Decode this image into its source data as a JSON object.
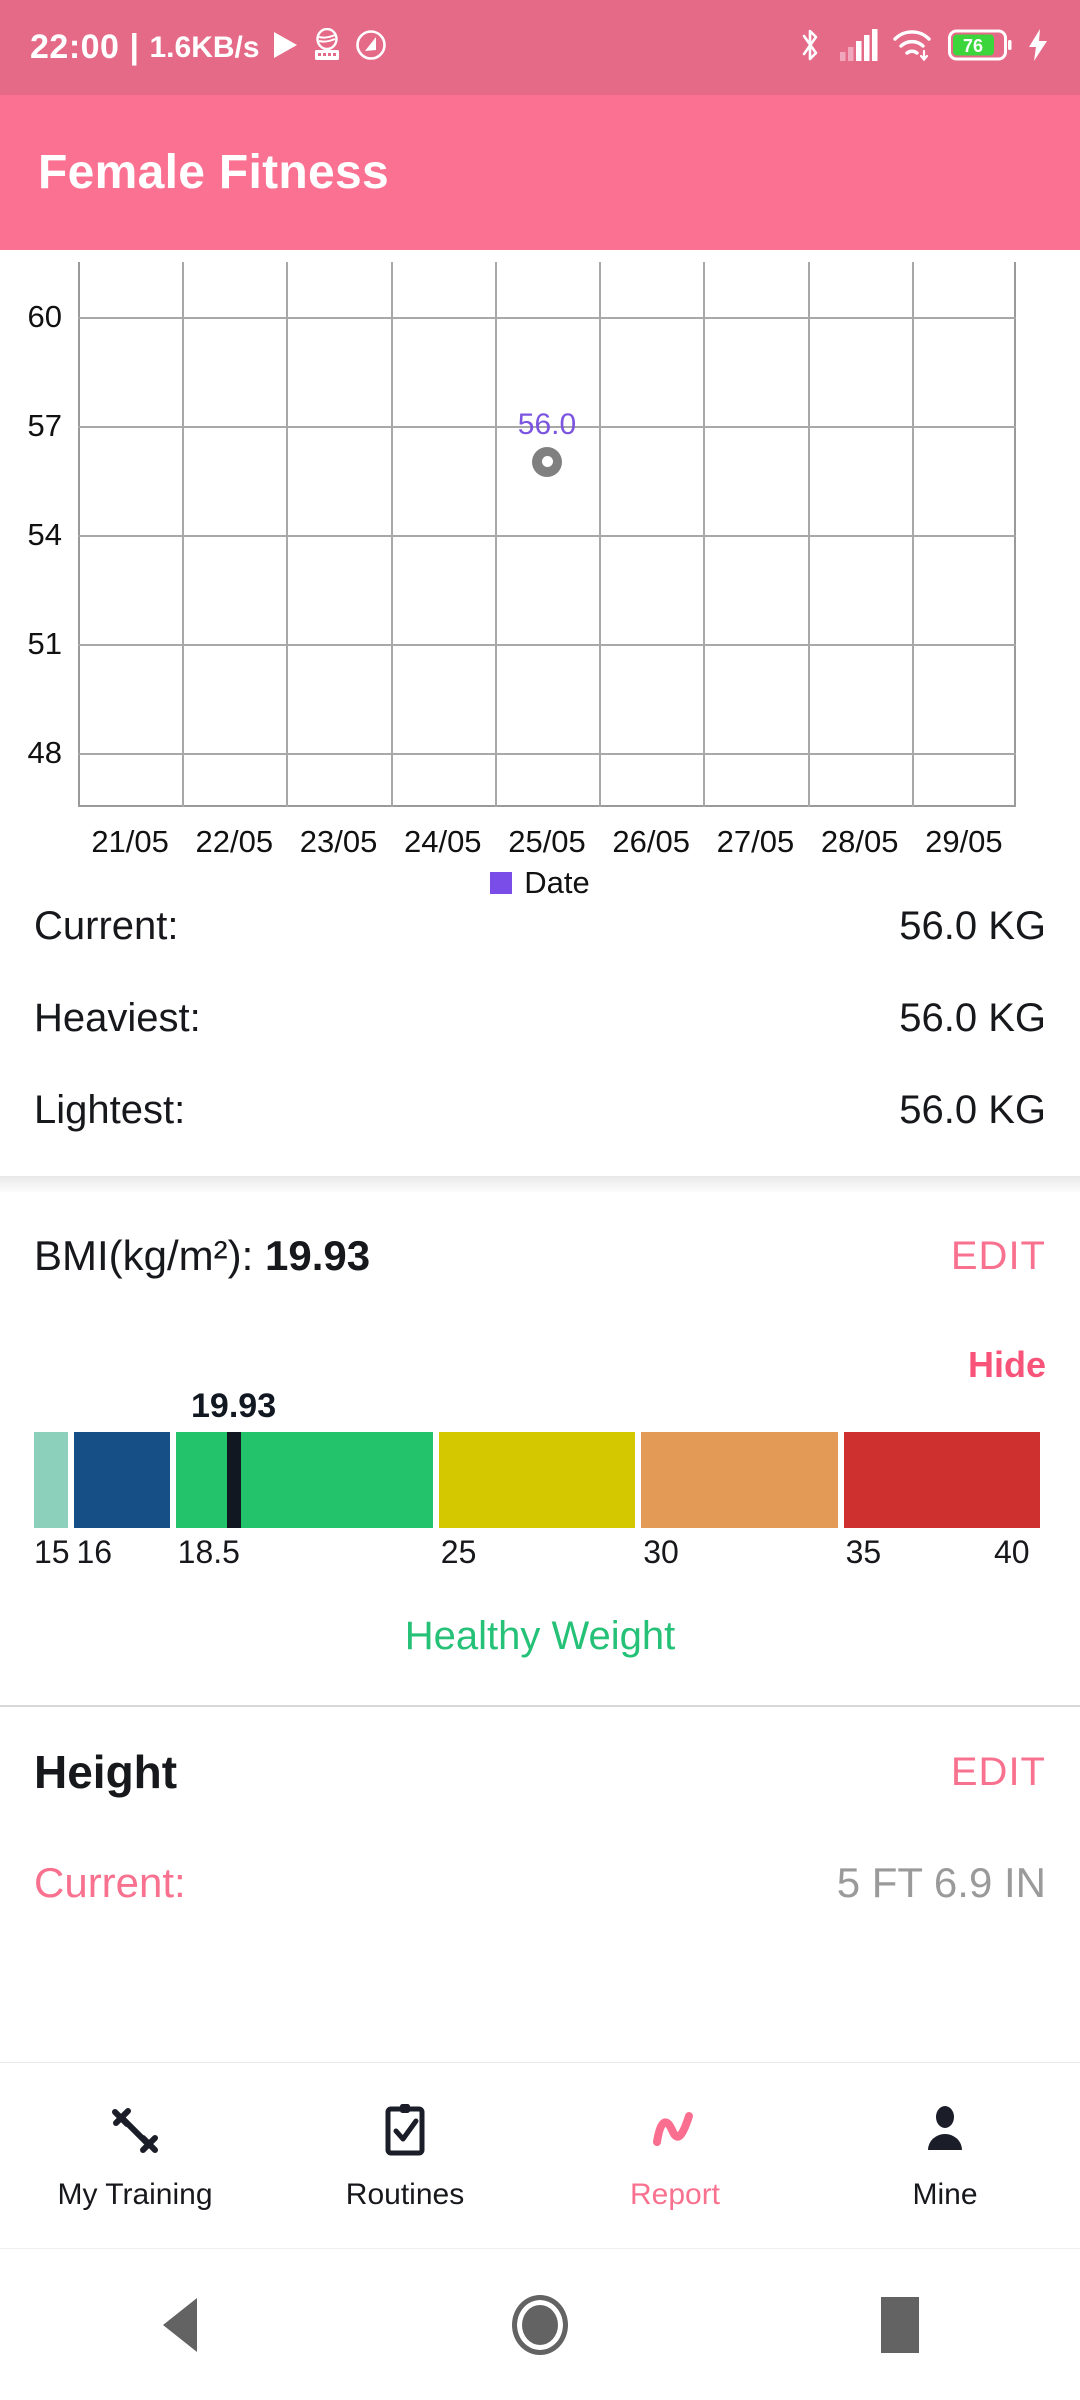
{
  "status_bar": {
    "clock": "22:00",
    "separator": "|",
    "net_speed": "1.6KB/s",
    "icons": [
      "play-icon",
      "keyboard-icon",
      "do-not-disturb-icon",
      "bluetooth-icon",
      "cellular-signal-icon",
      "wifi-icon",
      "battery-icon",
      "charging-bolt-icon"
    ],
    "battery_percent": "76"
  },
  "app_bar": {
    "title": "Female Fitness",
    "background": "#FA7192"
  },
  "chart_data": {
    "type": "scatter",
    "title": "",
    "xlabel": "",
    "ylabel": "",
    "x_tick_labels": [
      "21/05",
      "22/05",
      "23/05",
      "24/05",
      "25/05",
      "26/05",
      "27/05",
      "28/05",
      "29/05"
    ],
    "y_ticks": [
      48,
      51,
      54,
      57,
      60
    ],
    "ylim": [
      46.5,
      61.5
    ],
    "grid": true,
    "legend": {
      "position": "bottom",
      "entries": [
        {
          "name": "Date",
          "color": "#7B4DE8"
        }
      ]
    },
    "series": [
      {
        "name": "Date",
        "point_color": "#808080",
        "label_color": "#7B55E0",
        "points": [
          {
            "x": "25/05",
            "y": 56.0,
            "label": "56.0"
          }
        ]
      }
    ]
  },
  "weight_stats": {
    "rows": [
      {
        "label": "Current:",
        "value": "56.0 KG"
      },
      {
        "label": "Heaviest:",
        "value": "56.0 KG"
      },
      {
        "label": "Lightest:",
        "value": "56.0 KG"
      }
    ]
  },
  "bmi": {
    "title_prefix": "BMI(kg/m²): ",
    "value": "19.93",
    "edit_label": "EDIT",
    "hide_label": "Hide",
    "marker_value": 19.93,
    "marker_label": "19.93",
    "status_text": "Healthy Weight",
    "status_color": "#24C177",
    "scale_min": 15,
    "scale_max": 40,
    "segments": [
      {
        "from": 15,
        "to": 16,
        "color": "#8CCFBA"
      },
      {
        "from": 16,
        "to": 18.5,
        "color": "#164F85"
      },
      {
        "from": 18.5,
        "to": 25,
        "color": "#22C36A"
      },
      {
        "from": 25,
        "to": 30,
        "color": "#D4C800"
      },
      {
        "from": 30,
        "to": 35,
        "color": "#E39A57"
      },
      {
        "from": 35,
        "to": 40,
        "color": "#CE2F2F"
      }
    ],
    "tick_labels": [
      "15",
      "16",
      "18.5",
      "25",
      "30",
      "35",
      "40"
    ],
    "tick_values": [
      15,
      16,
      18.5,
      25,
      30,
      35,
      40
    ]
  },
  "height": {
    "title": "Height",
    "edit_label": "EDIT",
    "current_label": "Current:",
    "current_value": "5 FT 6.9 IN"
  },
  "bottom_nav": {
    "items": [
      {
        "label": "My Training",
        "icon": "dumbbell-icon",
        "active": false
      },
      {
        "label": "Routines",
        "icon": "clipboard-check-icon",
        "active": false
      },
      {
        "label": "Report",
        "icon": "line-chart-icon",
        "active": true
      },
      {
        "label": "Mine",
        "icon": "person-icon",
        "active": false
      }
    ],
    "active_color": "#F8728F"
  },
  "android_nav": {
    "back": "back-triangle-icon",
    "home": "home-circle-icon",
    "recents": "recents-square-icon"
  }
}
